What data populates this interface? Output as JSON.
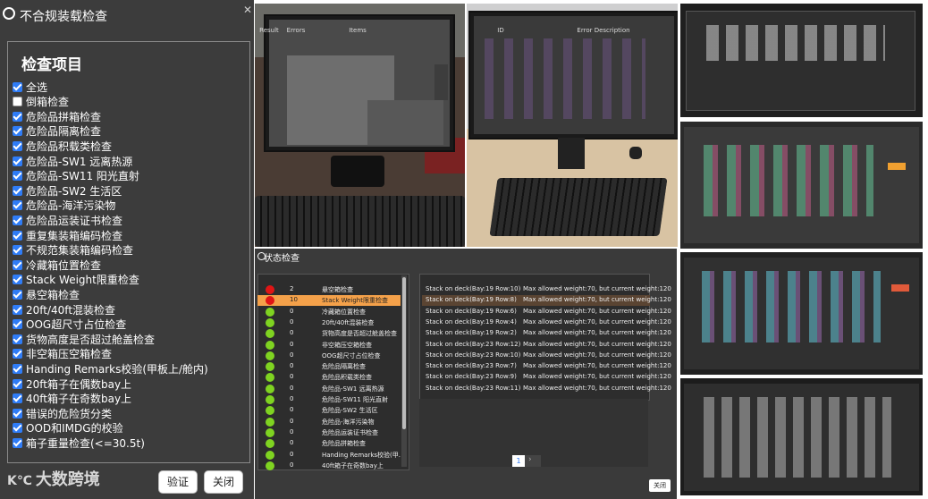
{
  "left_dialog": {
    "title": "不合规装载检查",
    "close": "✕",
    "group_label": "检查项目",
    "items": [
      {
        "label": "全选",
        "checked": true
      },
      {
        "label": "倒箱检查",
        "checked": false
      },
      {
        "label": "危险品拼箱检查",
        "checked": true
      },
      {
        "label": "危险品隔离检查",
        "checked": true
      },
      {
        "label": "危险品积载类检查",
        "checked": true
      },
      {
        "label": "危险品-SW1 远离热源",
        "checked": true
      },
      {
        "label": "危险品-SW11 阳光直射",
        "checked": true
      },
      {
        "label": "危险品-SW2 生活区",
        "checked": true
      },
      {
        "label": "危险品-海洋污染物",
        "checked": true
      },
      {
        "label": "危险品运装证书检查",
        "checked": true
      },
      {
        "label": "重复集装箱编码检查",
        "checked": true
      },
      {
        "label": "不规范集装箱编码检查",
        "checked": true
      },
      {
        "label": "冷藏箱位置检查",
        "checked": true
      },
      {
        "label": "Stack Weight限重检查",
        "checked": true
      },
      {
        "label": "悬空箱检查",
        "checked": true
      },
      {
        "label": "20ft/40ft混装检查",
        "checked": true
      },
      {
        "label": "OOG超尺寸占位检查",
        "checked": true
      },
      {
        "label": "货物高度是否超过舱盖检查",
        "checked": true
      },
      {
        "label": "非空箱压空箱检查",
        "checked": true
      },
      {
        "label": "Handing Remarks校验(甲板上/舱内)",
        "checked": true
      },
      {
        "label": "20ft箱子在偶数bay上",
        "checked": true
      },
      {
        "label": "40ft箱子在奇数bay上",
        "checked": true
      },
      {
        "label": "错误的危险货分类",
        "checked": true
      },
      {
        "label": "OOD和IMDG的校验",
        "checked": true
      },
      {
        "label": "箱子重量检查(<=30.5t)",
        "checked": true
      }
    ],
    "logo": "大数跨境",
    "verify_label": "验证",
    "close_label": "关闭"
  },
  "status_dialog": {
    "title": "状态检查",
    "headers": {
      "result": "Result",
      "errors": "Errors",
      "items": "Items",
      "id": "ID",
      "desc": "Error Description"
    },
    "rows": [
      {
        "result": "red",
        "errors": "2",
        "item": "悬空箱检查"
      },
      {
        "result": "red",
        "errors": "10",
        "item": "Stack Weight限重检查",
        "selected": true
      },
      {
        "result": "green",
        "errors": "0",
        "item": "冷藏箱位置检查"
      },
      {
        "result": "green",
        "errors": "0",
        "item": "20ft/40ft混装检查"
      },
      {
        "result": "green",
        "errors": "0",
        "item": "货物高度是否超过舱盖检查"
      },
      {
        "result": "green",
        "errors": "0",
        "item": "非空箱压空箱检查"
      },
      {
        "result": "green",
        "errors": "0",
        "item": "OOG超尺寸占位检查"
      },
      {
        "result": "green",
        "errors": "0",
        "item": "危险品隔离检查"
      },
      {
        "result": "green",
        "errors": "0",
        "item": "危险品积载类检查"
      },
      {
        "result": "green",
        "errors": "0",
        "item": "危险品-SW1 远离热源"
      },
      {
        "result": "green",
        "errors": "0",
        "item": "危险品-SW11 阳光直射"
      },
      {
        "result": "green",
        "errors": "0",
        "item": "危险品-SW2 生活区"
      },
      {
        "result": "green",
        "errors": "0",
        "item": "危险品-海洋污染物"
      },
      {
        "result": "green",
        "errors": "0",
        "item": "危险品运装证书检查"
      },
      {
        "result": "green",
        "errors": "0",
        "item": "危险品拼箱检查"
      },
      {
        "result": "green",
        "errors": "0",
        "item": "Handing Remarks校验(甲..."
      },
      {
        "result": "green",
        "errors": "0",
        "item": "40ft箱子在奇数bay上"
      }
    ],
    "details": [
      {
        "id": "Stack on deck(Bay:19 Row:10)",
        "desc": "Max allowed weight:70, but current weight:120"
      },
      {
        "id": "Stack on deck(Bay:19 Row:8)",
        "desc": "Max allowed weight:70, but current weight:120",
        "selected": true
      },
      {
        "id": "Stack on deck(Bay:19 Row:6)",
        "desc": "Max allowed weight:70, but current weight:120"
      },
      {
        "id": "Stack on deck(Bay:19 Row:4)",
        "desc": "Max allowed weight:70, but current weight:120"
      },
      {
        "id": "Stack on deck(Bay:19 Row:2)",
        "desc": "Max allowed weight:70, but current weight:120"
      },
      {
        "id": "Stack on deck(Bay:23 Row:12)",
        "desc": "Max allowed weight:70, but current weight:120"
      },
      {
        "id": "Stack on deck(Bay:23 Row:10)",
        "desc": "Max allowed weight:70, but current weight:120"
      },
      {
        "id": "Stack on deck(Bay:23 Row:7)",
        "desc": "Max allowed weight:70, but current weight:120"
      },
      {
        "id": "Stack on deck(Bay:23 Row:9)",
        "desc": "Max allowed weight:70, but current weight:120"
      },
      {
        "id": "Stack on deck(Bay:23 Row:11)",
        "desc": "Max allowed weight:70, but current weight:120"
      }
    ],
    "page": "1",
    "next": "›",
    "close_label": "关闭"
  },
  "colors": {
    "red": "#e01515",
    "green": "#7fd321",
    "selected": "#f4a14a",
    "checkbox": "#2f7cf6"
  }
}
